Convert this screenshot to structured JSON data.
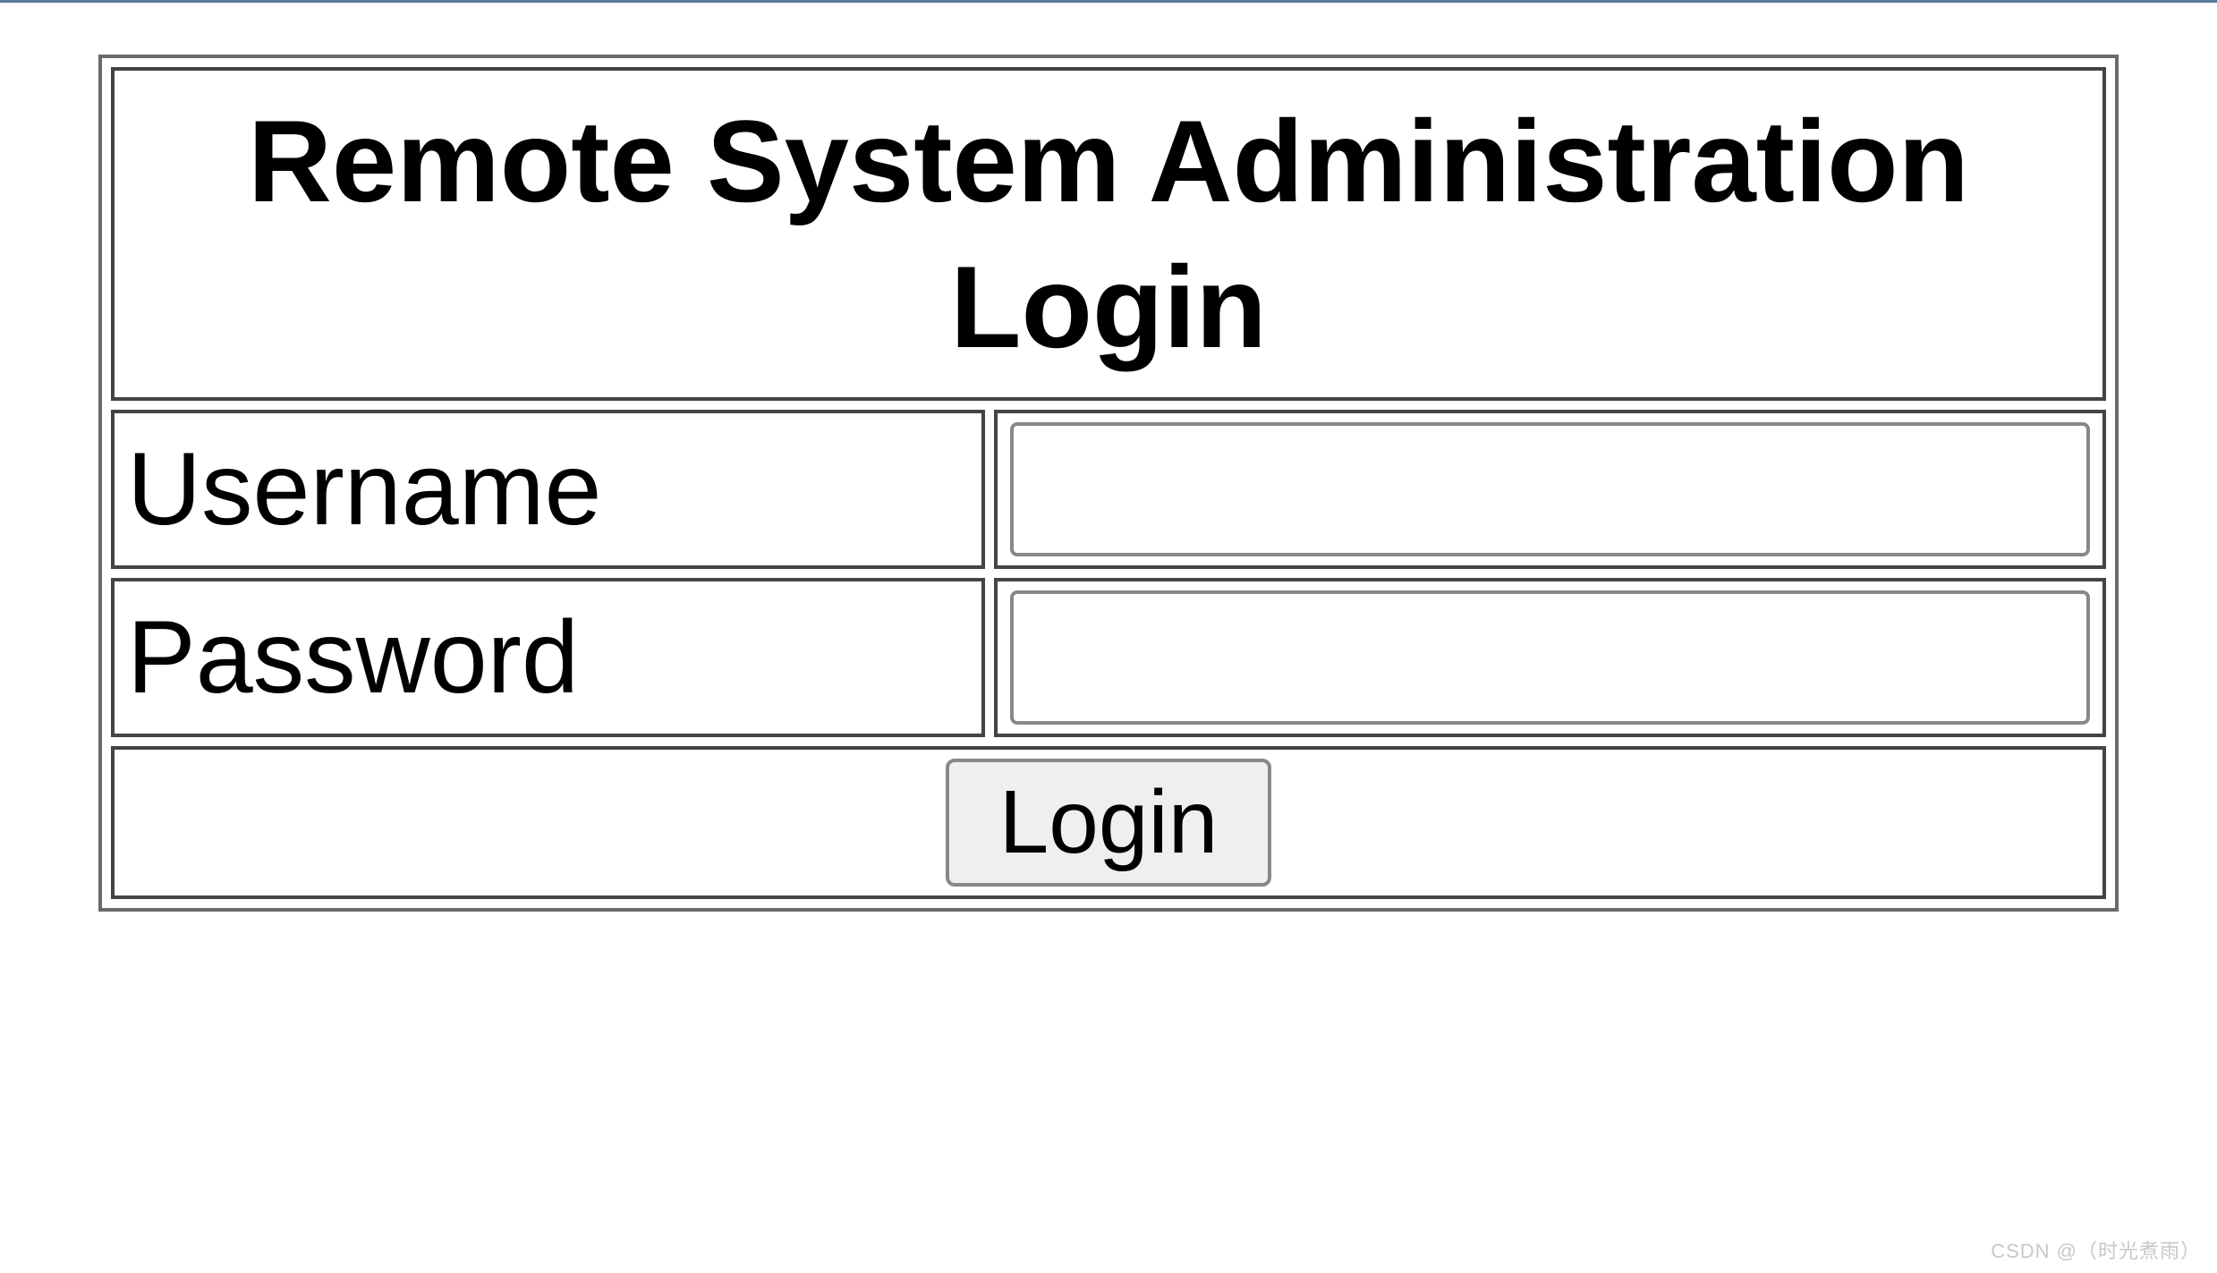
{
  "header": {
    "title": "Remote System Administration Login"
  },
  "form": {
    "username": {
      "label": "Username",
      "value": ""
    },
    "password": {
      "label": "Password",
      "value": ""
    },
    "submit_label": "Login"
  },
  "watermark": "CSDN @（时光煮雨）"
}
